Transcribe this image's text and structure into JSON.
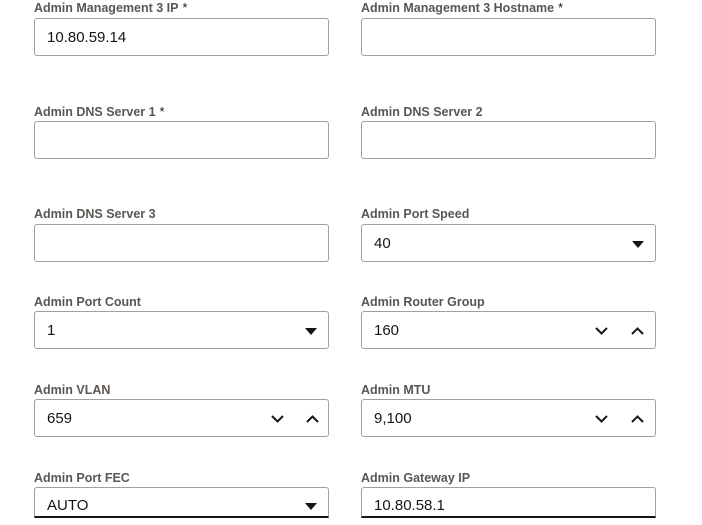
{
  "fields": {
    "admin_mgmt3_ip": {
      "label": "Admin Management 3 IP",
      "required": "*",
      "value": "10.80.59.14"
    },
    "admin_mgmt3_hostname": {
      "label": "Admin Management 3 Hostname",
      "required": "*",
      "value": ""
    },
    "admin_dns1": {
      "label": "Admin DNS Server 1",
      "required": "*",
      "value": ""
    },
    "admin_dns2": {
      "label": "Admin DNS Server 2",
      "value": ""
    },
    "admin_dns3": {
      "label": "Admin DNS Server 3",
      "value": ""
    },
    "admin_port_speed": {
      "label": "Admin Port Speed",
      "value": "40",
      "icon": "chevron-down-icon"
    },
    "admin_port_count": {
      "label": "Admin Port Count",
      "value": "1",
      "icon": "chevron-down-icon"
    },
    "admin_router_group": {
      "label": "Admin Router Group",
      "value": "160",
      "icons": [
        "decrement-chevron-down-icon",
        "increment-chevron-up-icon"
      ]
    },
    "admin_vlan": {
      "label": "Admin VLAN",
      "value": "659",
      "icons": [
        "decrement-chevron-down-icon",
        "increment-chevron-up-icon"
      ]
    },
    "admin_mtu": {
      "label": "Admin MTU",
      "value": "9,100",
      "icons": [
        "decrement-chevron-down-icon",
        "increment-chevron-up-icon"
      ]
    },
    "admin_port_fec": {
      "label": "Admin Port FEC",
      "value": "AUTO",
      "icon": "chevron-down-icon"
    },
    "admin_gateway_ip": {
      "label": "Admin Gateway IP",
      "value": "10.80.58.1"
    }
  },
  "colors": {
    "label": "#5b5652",
    "border": "#a3a09c",
    "text": "#161513"
  }
}
